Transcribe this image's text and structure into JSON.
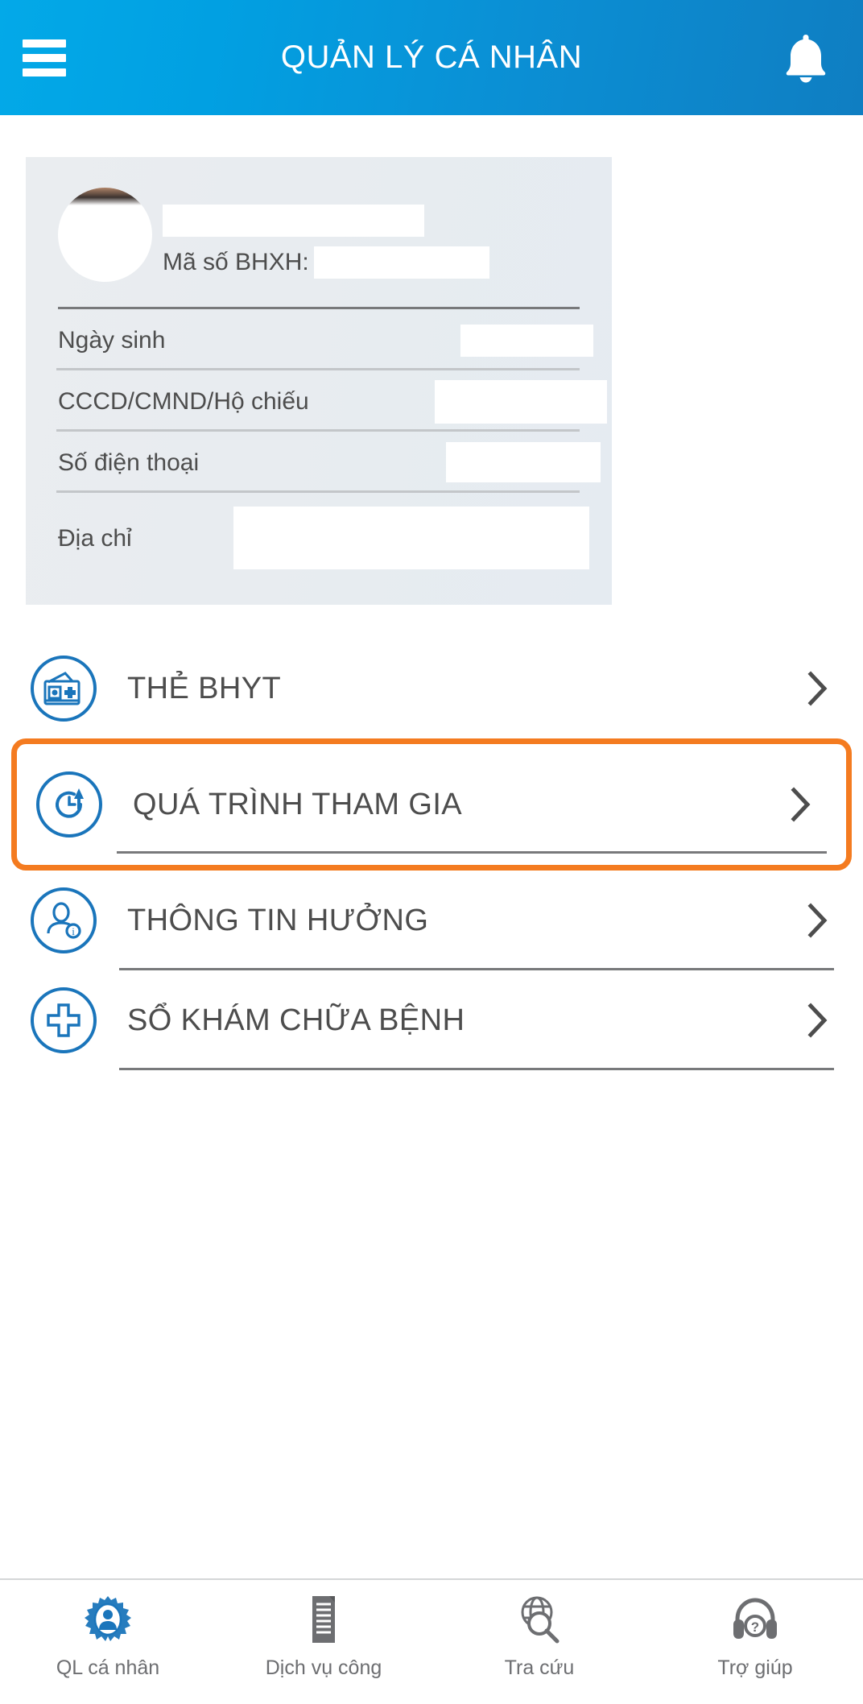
{
  "header": {
    "title": "QUẢN LÝ CÁ NHÂN",
    "menu_icon": "hamburger-menu-icon",
    "notification_icon": "bell-icon",
    "gradient_start": "#03a9e8",
    "gradient_end": "#0f7ec2"
  },
  "profile": {
    "avatar_label": "",
    "name_value": "",
    "bhxh_label": "Mã số BHXH:",
    "bhxh_value": "",
    "fields": [
      {
        "label": "Ngày sinh",
        "value": ""
      },
      {
        "label": "CCCD/CMND/Hộ chiếu",
        "value": ""
      },
      {
        "label": "Số điện thoại",
        "value": ""
      },
      {
        "label": "Địa chỉ",
        "value": ""
      }
    ]
  },
  "menu": {
    "highlight_color": "#f47b20",
    "icon_color": "#1a75bb",
    "items": [
      {
        "label": "THẺ BHYT",
        "icon": "insurance-card-icon",
        "highlighted": false
      },
      {
        "label": "QUÁ TRÌNH THAM GIA",
        "icon": "history-clock-icon",
        "highlighted": true
      },
      {
        "label": "THÔNG TIN HƯỞNG",
        "icon": "person-info-icon",
        "highlighted": false
      },
      {
        "label": "SỔ KHÁM CHỮA BỆNH",
        "icon": "medical-cross-icon",
        "highlighted": false
      }
    ],
    "chevron_icon": "chevron-right-icon"
  },
  "bottom_nav": {
    "items": [
      {
        "label": "QL cá nhân",
        "icon": "gear-person-icon",
        "active": true
      },
      {
        "label": "Dịch vụ công",
        "icon": "document-icon",
        "active": false
      },
      {
        "label": "Tra cứu",
        "icon": "globe-search-icon",
        "active": false
      },
      {
        "label": "Trợ giúp",
        "icon": "headset-help-icon",
        "active": false
      }
    ],
    "active_color": "#1a75bb",
    "inactive_color": "#6d6e71"
  }
}
